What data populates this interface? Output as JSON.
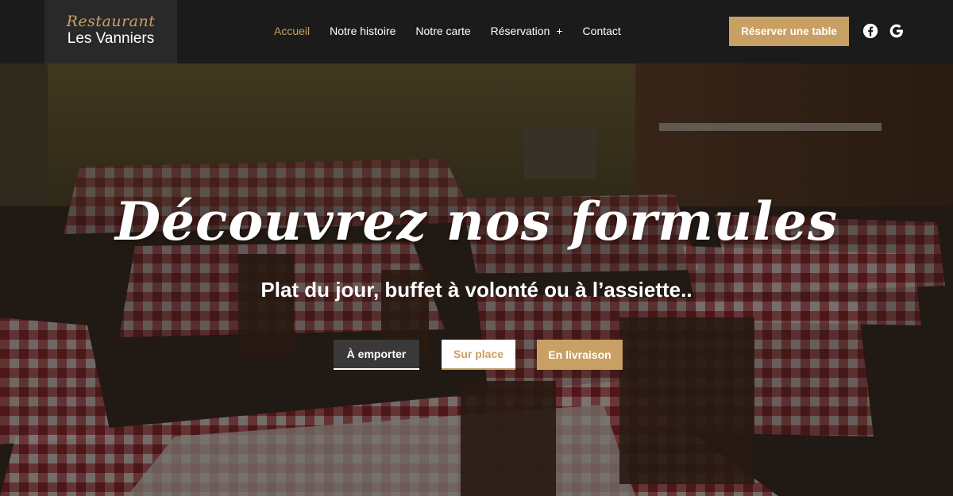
{
  "header": {
    "logo_script": "Restaurant",
    "logo_name": "Les Vanniers",
    "nav": [
      {
        "label": "Accueil",
        "active": true
      },
      {
        "label": "Notre histoire",
        "active": false
      },
      {
        "label": "Notre carte",
        "active": false
      },
      {
        "label": "Réservation",
        "active": false,
        "expand": "+"
      },
      {
        "label": "Contact",
        "active": false
      }
    ],
    "cta_label": "Réserver une table",
    "social_icons": [
      "facebook-icon",
      "google-icon"
    ]
  },
  "hero": {
    "title": "Découvrez nos formules",
    "subtitle": "Plat du jour, buffet à volonté ou à l’assiette..",
    "buttons": [
      {
        "label": "À emporter"
      },
      {
        "label": "Sur place"
      },
      {
        "label": "En livraison"
      }
    ]
  },
  "colors": {
    "accent": "#c9a063",
    "header_bg": "#1b1b1b",
    "logo_bg": "#2a2929",
    "tablecloth_red": "#c23a45"
  }
}
